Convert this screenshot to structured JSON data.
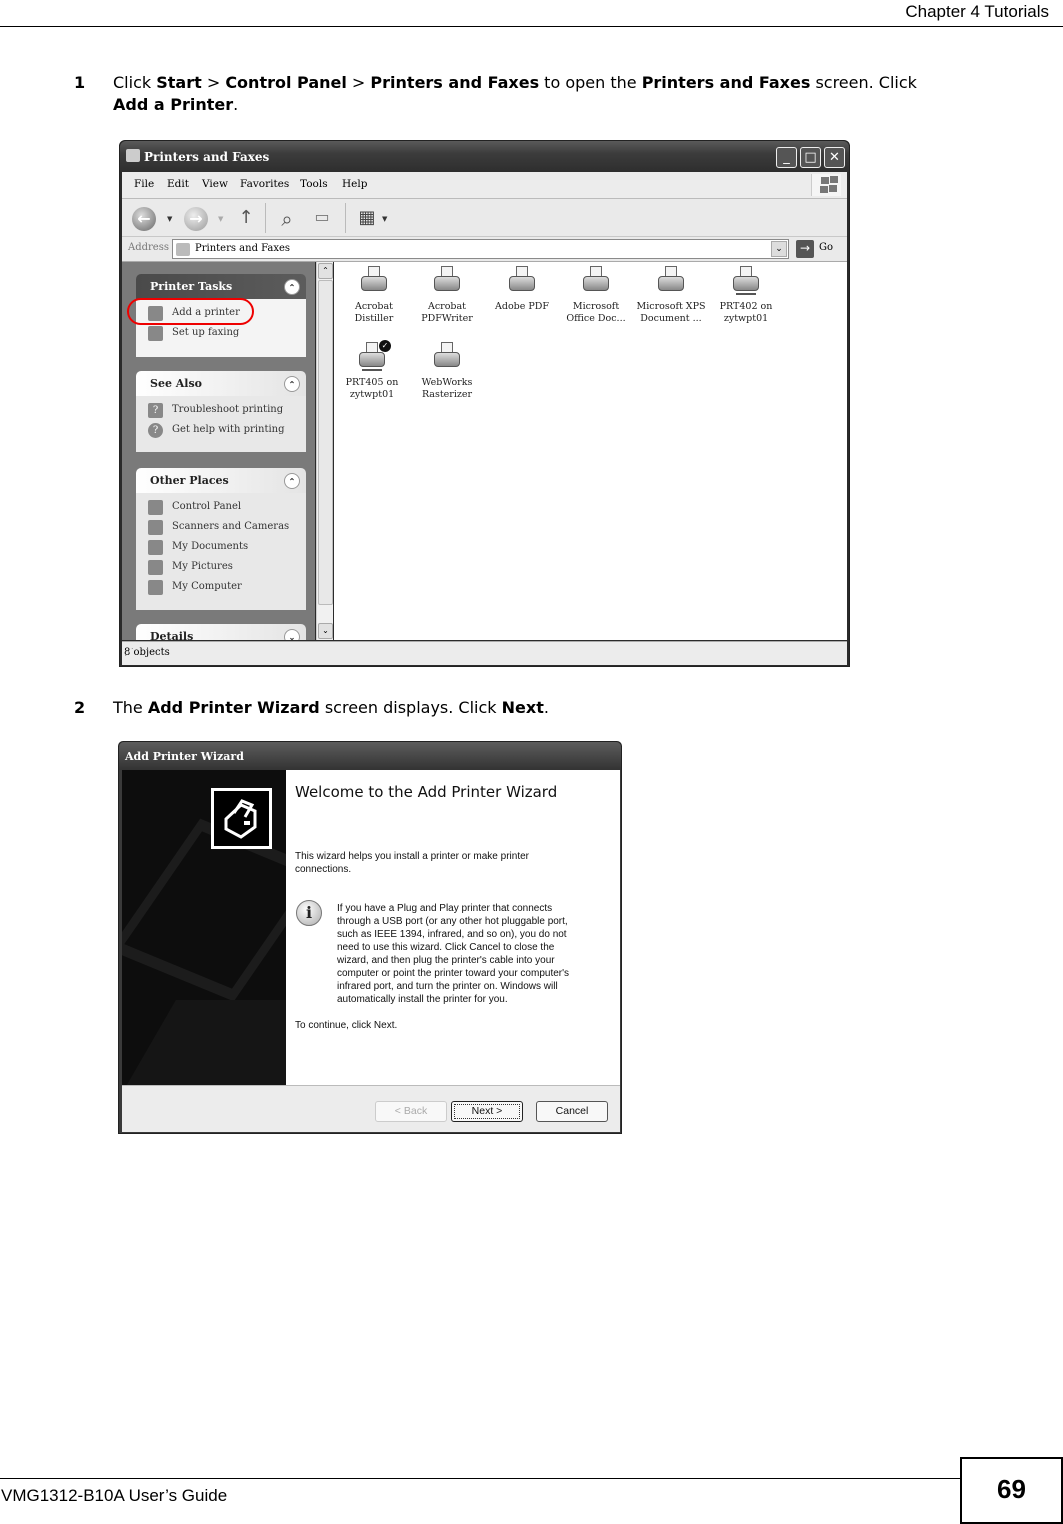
{
  "header": {
    "chapter": "Chapter 4 Tutorials"
  },
  "steps": [
    {
      "number": "1",
      "parts": [
        "Click ",
        "Start",
        " > ",
        "Control Panel",
        " > ",
        "Printers and Faxes",
        " to open the ",
        "Printers and Faxes",
        " screen. Click ",
        "Add a Printer",
        "."
      ]
    },
    {
      "number": "2",
      "parts": [
        "The ",
        "Add Printer Wizard",
        " screen displays. Click ",
        "Next",
        "."
      ]
    }
  ],
  "explorer": {
    "title": "Printers and Faxes",
    "window_buttons": {
      "minimize": "_",
      "maximize": "□",
      "close": "✕"
    },
    "menu": [
      "File",
      "Edit",
      "View",
      "Favorites",
      "Tools",
      "Help"
    ],
    "toolbar": {
      "back": "←",
      "forward": "→",
      "up": "↑",
      "search": "⌕",
      "folders": "▭",
      "views": "▦"
    },
    "address": {
      "label": "Address",
      "value": "Printers and Faxes",
      "go": "Go"
    },
    "task_panes": [
      {
        "title": "Printer Tasks",
        "chevron": "⌃",
        "items": [
          {
            "label": "Add a printer",
            "icon": "add-printer-icon"
          },
          {
            "label": "Set up faxing",
            "icon": "fax-icon"
          }
        ]
      },
      {
        "title": "See Also",
        "chevron": "⌃",
        "items": [
          {
            "label": "Troubleshoot printing",
            "icon": "troubleshoot-icon"
          },
          {
            "label": "Get help with printing",
            "icon": "help-icon"
          }
        ]
      },
      {
        "title": "Other Places",
        "chevron": "⌃",
        "items": [
          {
            "label": "Control Panel",
            "icon": "control-panel-icon"
          },
          {
            "label": "Scanners and Cameras",
            "icon": "scanner-icon"
          },
          {
            "label": "My Documents",
            "icon": "documents-icon"
          },
          {
            "label": "My Pictures",
            "icon": "pictures-icon"
          },
          {
            "label": "My Computer",
            "icon": "computer-icon"
          }
        ]
      },
      {
        "title": "Details",
        "chevron": "⌄",
        "items": []
      }
    ],
    "printers": [
      {
        "line1": "Acrobat",
        "line2": "Distiller"
      },
      {
        "line1": "Acrobat",
        "line2": "PDFWriter"
      },
      {
        "line1": "Adobe PDF",
        "line2": ""
      },
      {
        "line1": "Microsoft",
        "line2": "Office Doc..."
      },
      {
        "line1": "Microsoft XPS",
        "line2": "Document ..."
      },
      {
        "line1": "PRT402 on",
        "line2": "zytwpt01",
        "network": true
      },
      {
        "line1": "PRT405 on",
        "line2": "zytwpt01",
        "network": true,
        "default": true
      },
      {
        "line1": "WebWorks",
        "line2": "Rasterizer"
      }
    ],
    "status": "8 objects"
  },
  "wizard": {
    "title": "Add Printer Wizard",
    "heading": "Welcome to the Add Printer Wizard",
    "intro": "This wizard helps you install a printer or make printer connections.",
    "info": "If you have a Plug and Play printer that connects through a USB port (or any other hot pluggable port, such as IEEE 1394, infrared, and so on), you do not need to use this wizard. Click Cancel to close the wizard, and then plug the printer's cable into your computer or point the printer toward your computer's infrared port, and turn the printer on. Windows will automatically install the printer for you.",
    "continue": "To continue, click Next.",
    "buttons": {
      "back": "< Back",
      "next": "Next >",
      "cancel": "Cancel"
    }
  },
  "footer": {
    "guide": "VMG1312-B10A User’s Guide",
    "page": "69"
  }
}
